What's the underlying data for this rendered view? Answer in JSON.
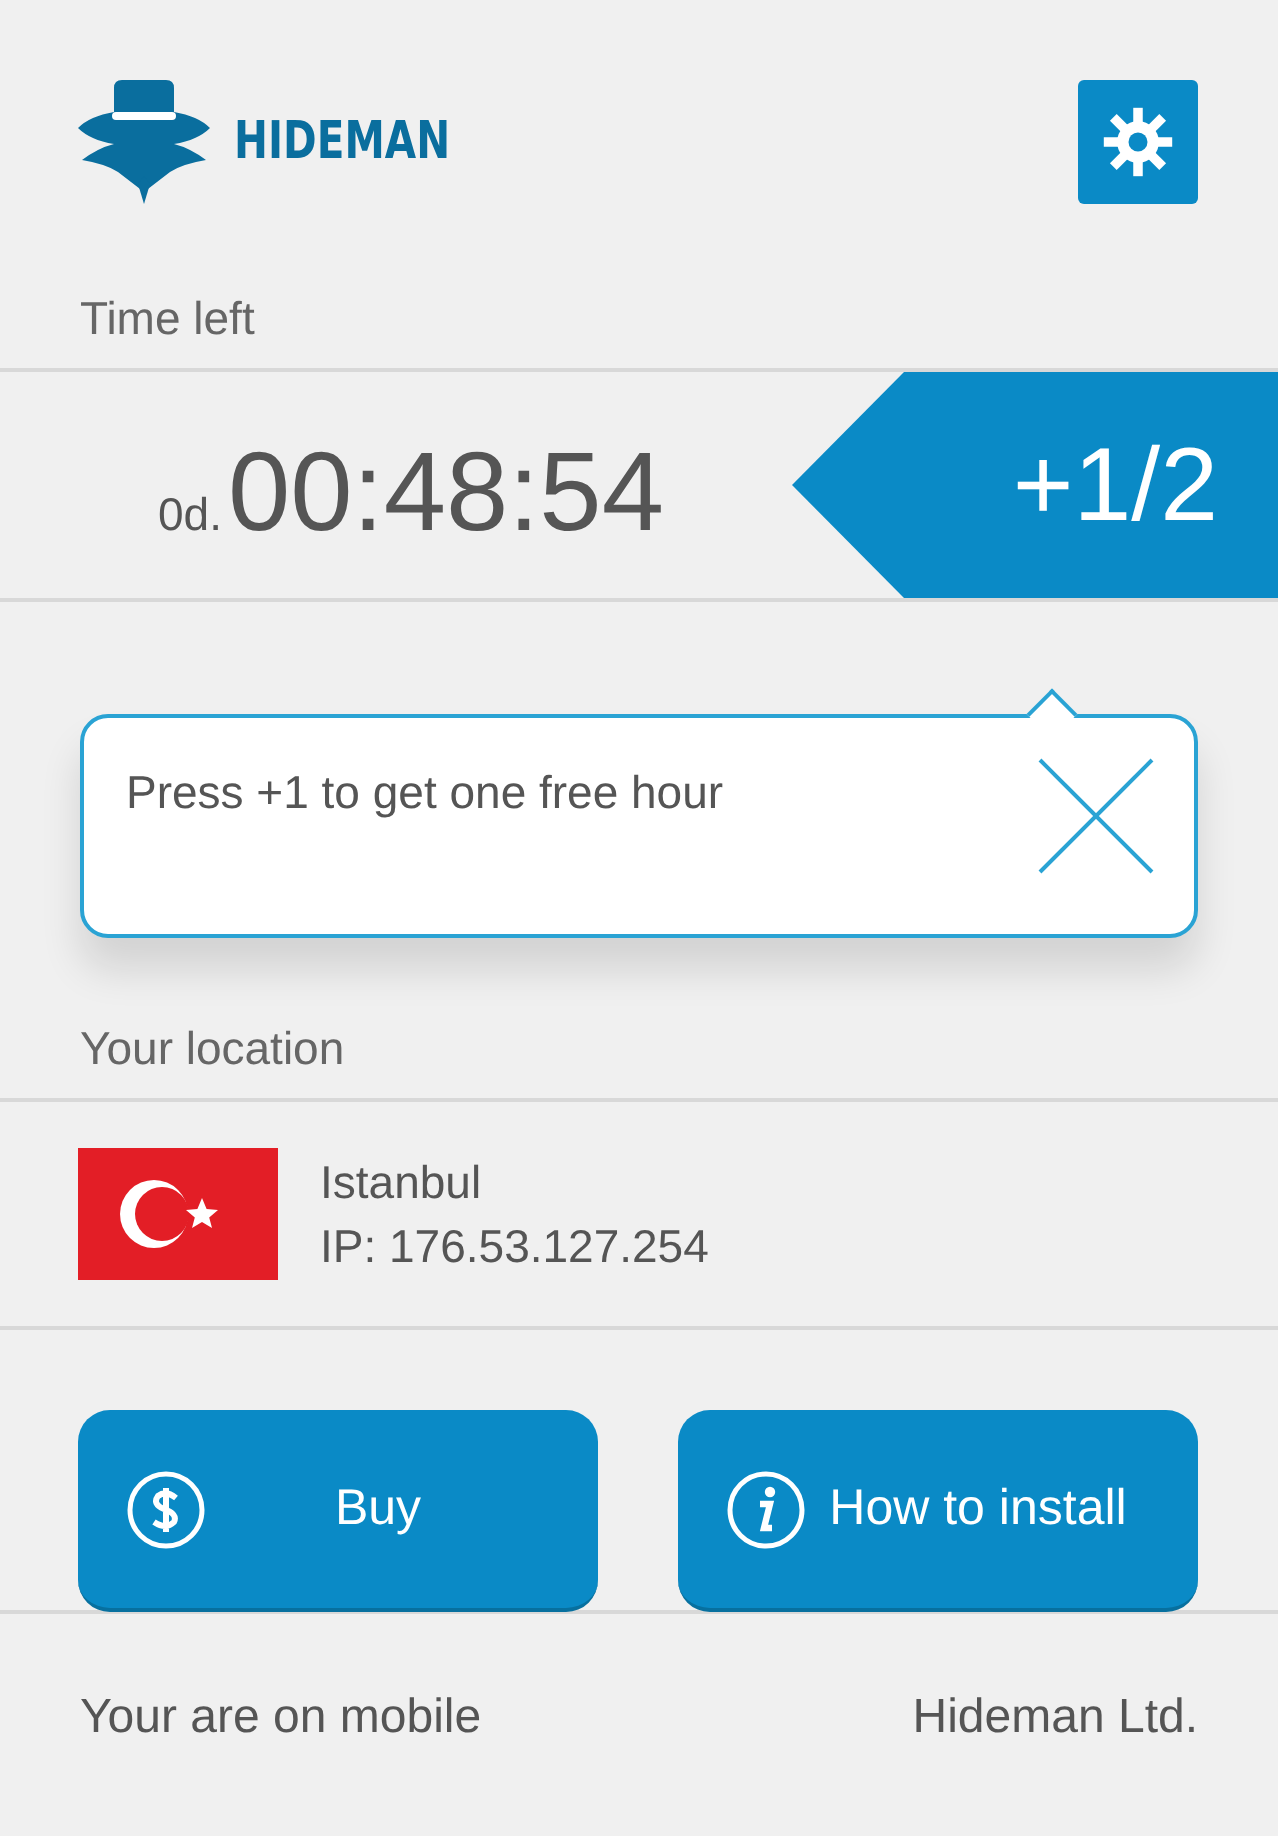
{
  "header": {
    "brand": "HIDEMAN"
  },
  "time": {
    "label": "Time left",
    "days": "0d.",
    "clock": "00:48:54",
    "bonus": "+1/2"
  },
  "tip": {
    "text": "Press +1 to get one free hour"
  },
  "location": {
    "label": "Your location",
    "city": "Istanbul",
    "ip": "IP: 176.53.127.254"
  },
  "buttons": [
    {
      "kind": "buy",
      "label": "Buy"
    },
    {
      "kind": "info",
      "label": "How to install"
    }
  ],
  "footer": {
    "left": "Your are on mobile",
    "right": "Hideman Ltd."
  }
}
